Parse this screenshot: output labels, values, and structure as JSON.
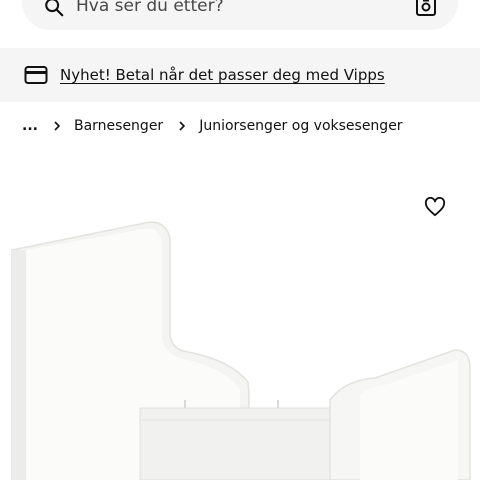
{
  "search": {
    "placeholder": "Hva ser du etter?"
  },
  "promo": {
    "text": "Nyhet! Betal når det passer deg med Vipps"
  },
  "breadcrumb": {
    "ellipsis": "...",
    "items": [
      {
        "label": "Barnesenger"
      },
      {
        "label": "Juniorsenger og voksesenger"
      }
    ]
  },
  "icons": {
    "search": "search-icon",
    "camera": "camera-search-icon",
    "card": "payment-card-icon",
    "chevron": "chevron-right-icon",
    "favorite": "heart-outline-icon"
  },
  "colors": {
    "text": "#111111",
    "banner_bg": "#f5f5f5",
    "search_bg": "#f5f5f5",
    "background": "#ffffff"
  }
}
